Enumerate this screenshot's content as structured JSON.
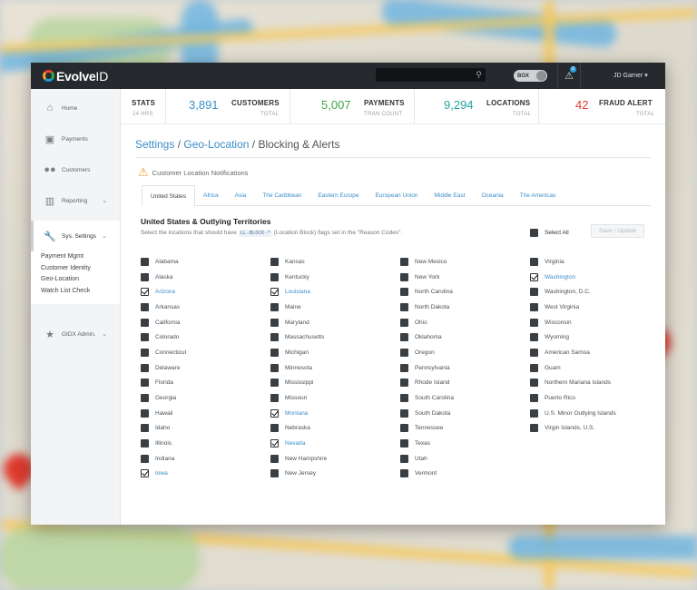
{
  "topbar": {
    "brand_part1": "Evolve",
    "brand_part2": "ID",
    "search_placeholder": "",
    "toggle_label": "BOX",
    "notification_count": "0",
    "user": "JD Garner ▾"
  },
  "sidebar": {
    "items": [
      {
        "label": "Home",
        "icon": "home-icon"
      },
      {
        "label": "Payments",
        "icon": "payments-icon"
      },
      {
        "label": "Customers",
        "icon": "customers-icon"
      },
      {
        "label": "Reporting",
        "icon": "reporting-icon"
      },
      {
        "label": "Sys. Settings",
        "icon": "wrench-icon"
      },
      {
        "label": "GIDX Admin.",
        "icon": "star-icon"
      }
    ],
    "sub_items": [
      "Payment Mgmt",
      "Customer Identity",
      "Geo-Location",
      "Watch List Check"
    ]
  },
  "stats": [
    {
      "label": "STATS",
      "sub": "24 HRS"
    },
    {
      "value": "3,891",
      "label": "CUSTOMERS",
      "sub": "TOTAL",
      "color": "#3a8fc9"
    },
    {
      "value": "5,007",
      "label": "PAYMENTS",
      "sub": "TRAN COUNT",
      "color": "#3fa64a"
    },
    {
      "value": "9,294",
      "label": "LOCATIONS",
      "sub": "TOTAL",
      "color": "#23a3a0"
    },
    {
      "value": "42",
      "label": "FRAUD ALERT",
      "sub": "TOTAL",
      "color": "#e03a2f"
    }
  ],
  "breadcrumb": {
    "part1": "Settings",
    "sep1": " / ",
    "part2": "Geo-Location",
    "sep2": " / ",
    "part3": "Blocking & Alerts"
  },
  "notice": "Customer Location Notifications",
  "tabs": [
    "United States",
    "Africa",
    "Asia",
    "The Caribbean",
    "Eastern Europe",
    "European Union",
    "Middle East",
    "Oceania",
    "The Americas"
  ],
  "section": {
    "title": "United States & Outlying Territories",
    "desc_before": "Select the locations that should have",
    "code": "LL-BLOCK-*",
    "desc_after": "(Location Block) flags set in the \"Reason Codes\"."
  },
  "select_all": "Select All",
  "save_button": "Save / Update",
  "columns": [
    [
      {
        "name": "Alabama",
        "checked": false
      },
      {
        "name": "Alaska",
        "checked": false
      },
      {
        "name": "Arizona",
        "checked": true
      },
      {
        "name": "Arkansas",
        "checked": false
      },
      {
        "name": "California",
        "checked": false
      },
      {
        "name": "Colorado",
        "checked": false
      },
      {
        "name": "Connecticut",
        "checked": false
      },
      {
        "name": "Delaware",
        "checked": false
      },
      {
        "name": "Florida",
        "checked": false
      },
      {
        "name": "Georgia",
        "checked": false
      },
      {
        "name": "Hawaii",
        "checked": false
      },
      {
        "name": "Idaho",
        "checked": false
      },
      {
        "name": "Illinois",
        "checked": false
      },
      {
        "name": "Indiana",
        "checked": false
      },
      {
        "name": "Iowa",
        "checked": true
      }
    ],
    [
      {
        "name": "Kansas",
        "checked": false
      },
      {
        "name": "Kentucky",
        "checked": false
      },
      {
        "name": "Louisiana",
        "checked": true
      },
      {
        "name": "Maine",
        "checked": false
      },
      {
        "name": "Maryland",
        "checked": false
      },
      {
        "name": "Massachusetts",
        "checked": false
      },
      {
        "name": "Michigan",
        "checked": false
      },
      {
        "name": "Minnesota",
        "checked": false
      },
      {
        "name": "Mississippi",
        "checked": false
      },
      {
        "name": "Missouri",
        "checked": false
      },
      {
        "name": "Montana",
        "checked": true
      },
      {
        "name": "Nebraska",
        "checked": false
      },
      {
        "name": "Nevada",
        "checked": true
      },
      {
        "name": "New Hampshire",
        "checked": false
      },
      {
        "name": "New Jersey",
        "checked": false
      }
    ],
    [
      {
        "name": "New Mexico",
        "checked": false
      },
      {
        "name": "New York",
        "checked": false
      },
      {
        "name": "North Carolina",
        "checked": false
      },
      {
        "name": "North Dakota",
        "checked": false
      },
      {
        "name": "Ohio",
        "checked": false
      },
      {
        "name": "Oklahoma",
        "checked": false
      },
      {
        "name": "Oregon",
        "checked": false
      },
      {
        "name": "Pennsylvania",
        "checked": false
      },
      {
        "name": "Rhode Island",
        "checked": false
      },
      {
        "name": "South Carolina",
        "checked": false
      },
      {
        "name": "South Dakota",
        "checked": false
      },
      {
        "name": "Tennessee",
        "checked": false
      },
      {
        "name": "Texas",
        "checked": false
      },
      {
        "name": "Utah",
        "checked": false
      },
      {
        "name": "Vermont",
        "checked": false
      }
    ],
    [
      {
        "name": "Virginia",
        "checked": false
      },
      {
        "name": "Washington",
        "checked": true
      },
      {
        "name": "Washington, D.C.",
        "checked": false
      },
      {
        "name": "West Virginia",
        "checked": false
      },
      {
        "name": "Wisconsin",
        "checked": false
      },
      {
        "name": "Wyoming",
        "checked": false
      },
      {
        "name": "American Samoa",
        "checked": false
      },
      {
        "name": "Guam",
        "checked": false
      },
      {
        "name": "Northern Mariana Islands",
        "checked": false
      },
      {
        "name": "Puerto Rico",
        "checked": false
      },
      {
        "name": "U.S. Minor Outlying Islands",
        "checked": false
      },
      {
        "name": "Virgin Islands, U.S.",
        "checked": false
      }
    ]
  ]
}
